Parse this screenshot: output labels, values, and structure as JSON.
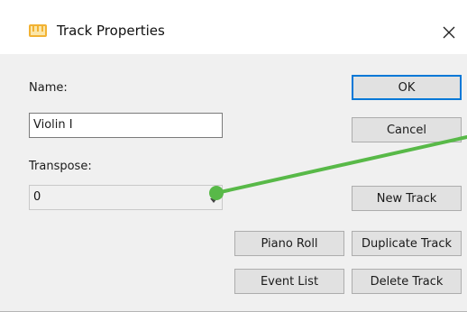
{
  "window": {
    "title": "Track Properties",
    "app_icon": "midi-keyboard-icon",
    "close_glyph": "✕"
  },
  "form": {
    "name_label": "Name:",
    "name_value": "Violin I",
    "transpose_label": "Transpose:",
    "transpose_value": "0"
  },
  "buttons": {
    "ok": "OK",
    "cancel": "Cancel",
    "new_track": "New Track",
    "piano_roll": "Piano Roll",
    "duplicate_track": "Duplicate Track",
    "event_list": "Event List",
    "delete_track": "Delete Track"
  },
  "colors": {
    "accent": "#0078d7",
    "pointer": "#58b948",
    "app_icon": "#f2b233"
  }
}
